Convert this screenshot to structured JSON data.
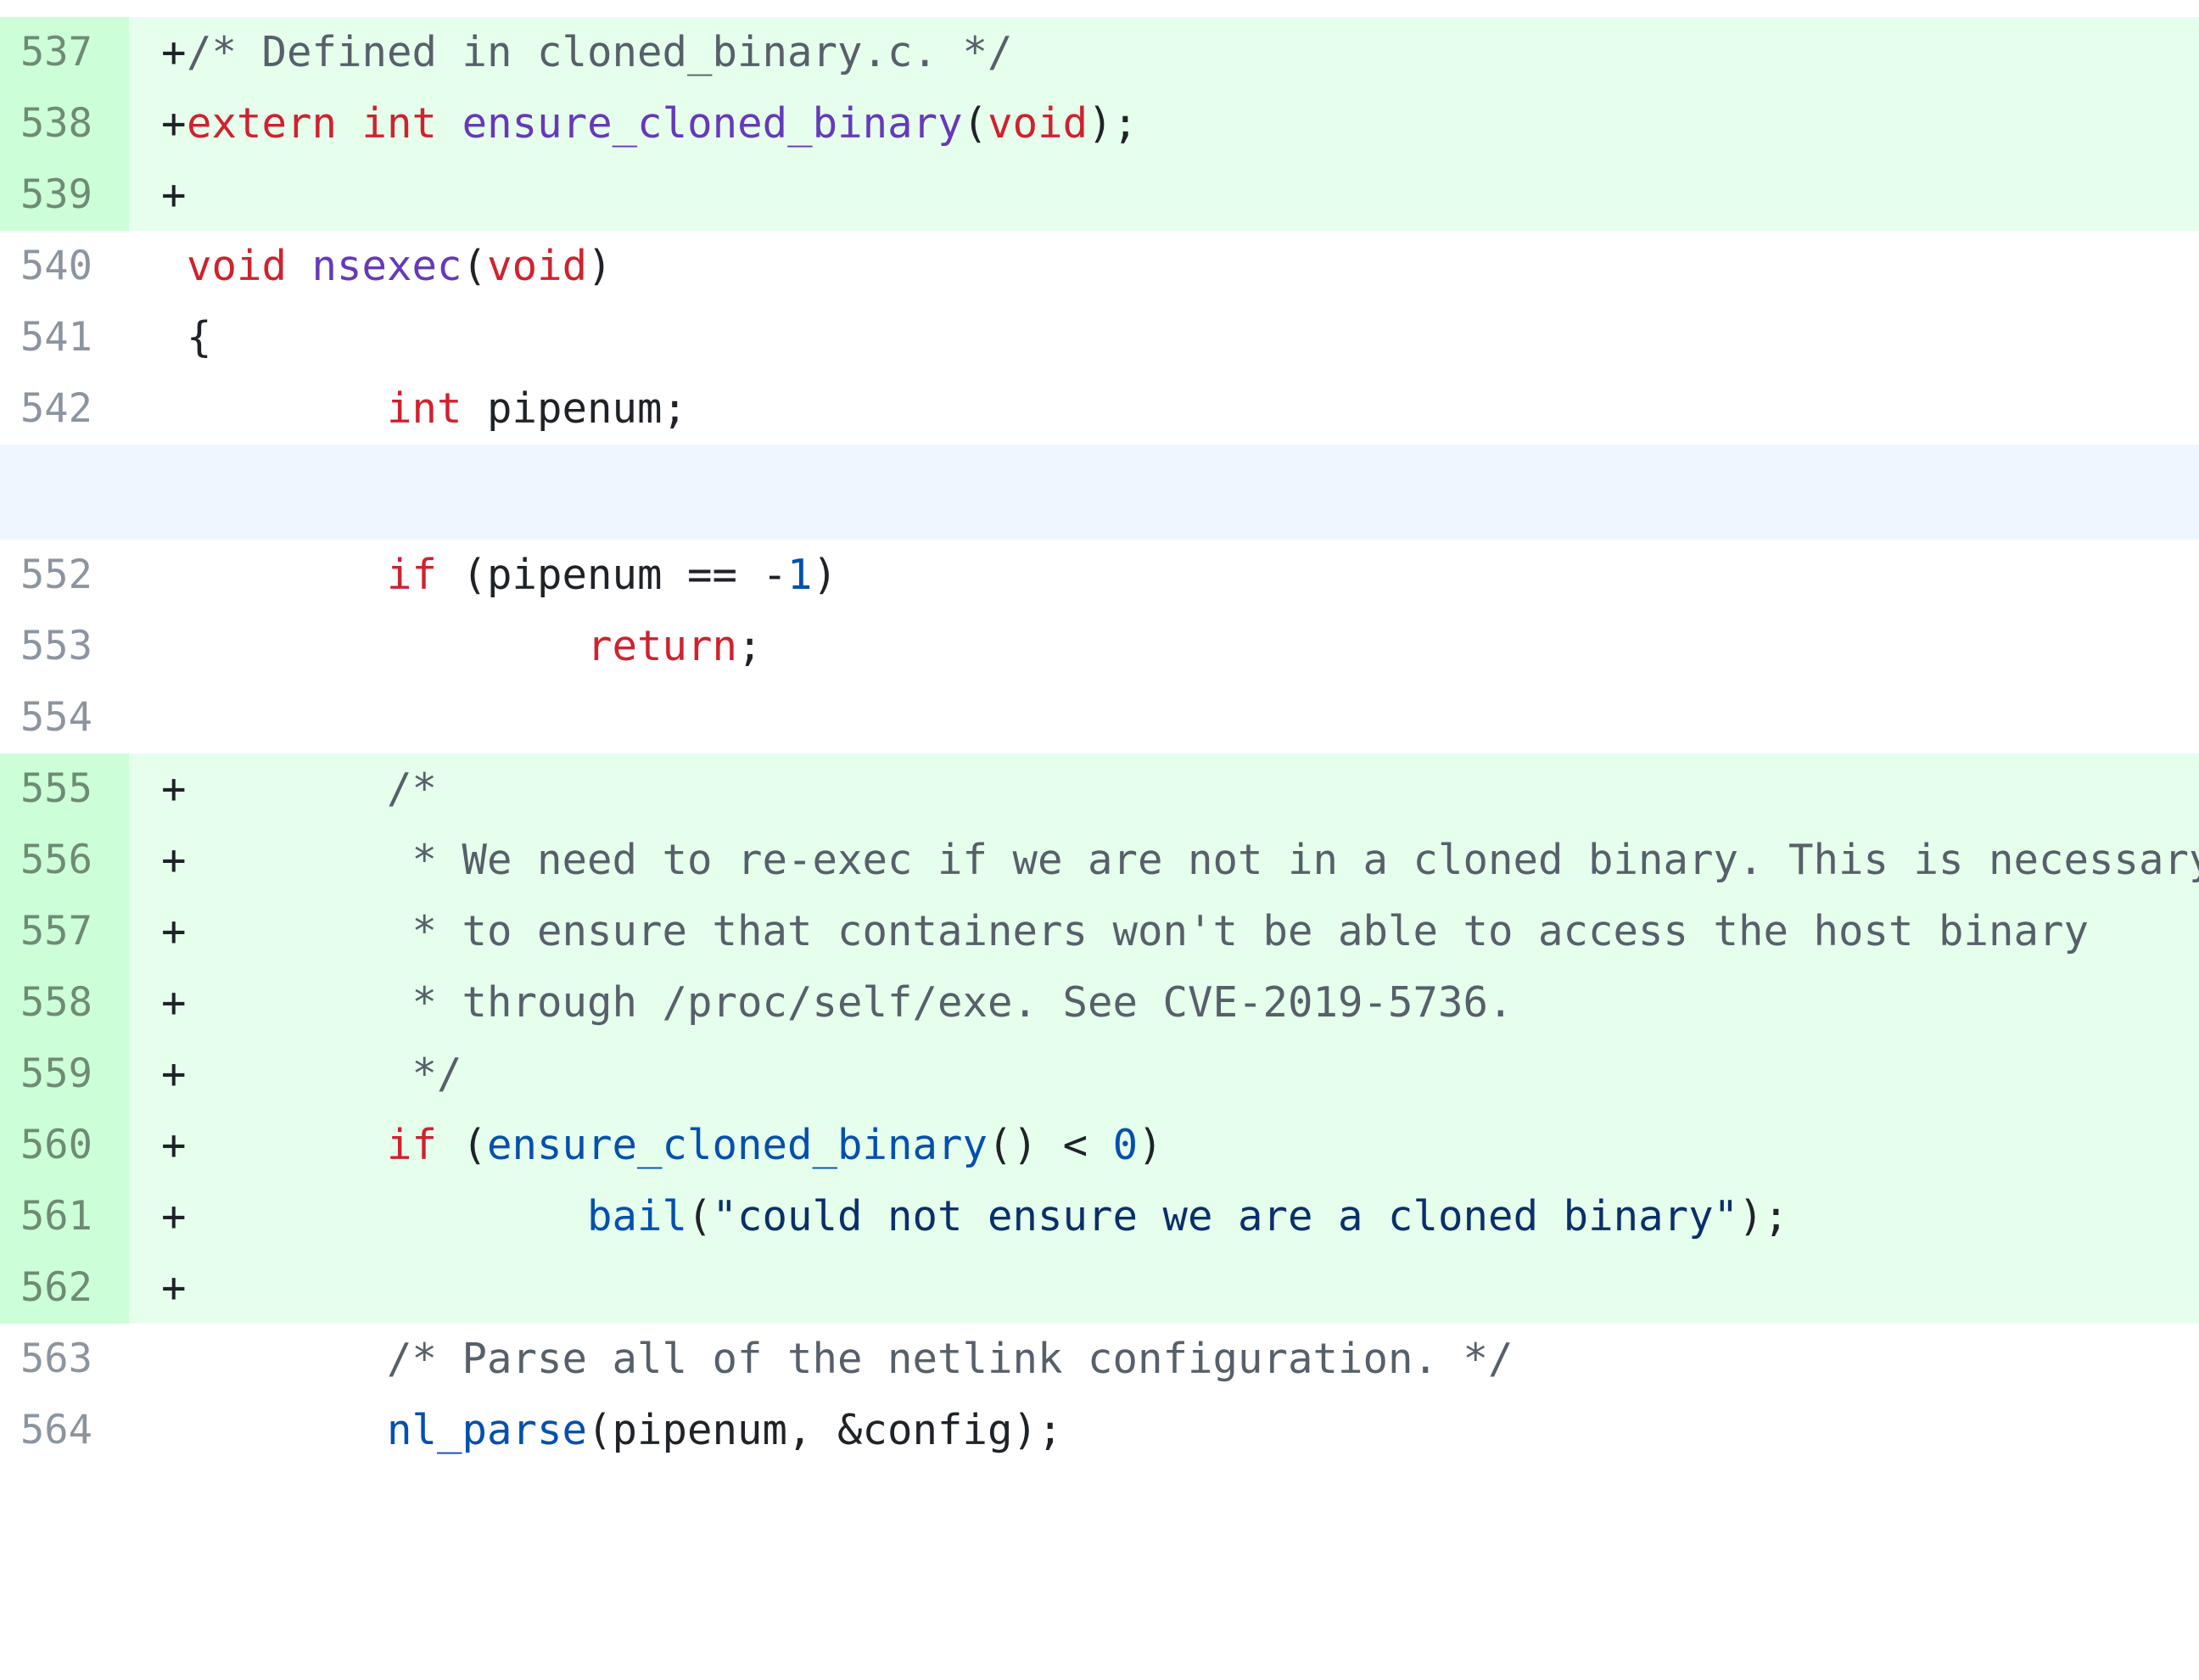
{
  "colors": {
    "added_background": "#e6ffec",
    "added_gutter": "#ccffd8",
    "hunk_background": "#f0f6ff",
    "keyword": "#cf222e",
    "function_name": "#6639ba",
    "call": "#0550ae",
    "string": "#0a3069",
    "comment": "#57606a",
    "line_number": "#8c959f"
  },
  "lines": [
    {
      "num": "537",
      "marker": "+",
      "tokens": [
        [
          "cm",
          "/* Defined in cloned_binary.c. */"
        ]
      ]
    },
    {
      "num": "538",
      "marker": "+",
      "tokens": [
        [
          "kw",
          "extern"
        ],
        [
          "",
          " "
        ],
        [
          "kw",
          "int"
        ],
        [
          "",
          " "
        ],
        [
          "fn",
          "ensure_cloned_binary"
        ],
        [
          "",
          "("
        ],
        [
          "kw",
          "void"
        ],
        [
          "",
          ");"
        ]
      ]
    },
    {
      "num": "539",
      "marker": "+",
      "tokens": []
    },
    {
      "num": "540",
      "marker": "",
      "tokens": [
        [
          "kw",
          "void"
        ],
        [
          "",
          " "
        ],
        [
          "fn",
          "nsexec"
        ],
        [
          "",
          "("
        ],
        [
          "kw",
          "void"
        ],
        [
          "",
          ")"
        ]
      ]
    },
    {
      "num": "541",
      "marker": "",
      "tokens": [
        [
          "",
          "{"
        ]
      ]
    },
    {
      "num": "542",
      "marker": "",
      "tokens": [
        [
          "",
          "        "
        ],
        [
          "kw",
          "int"
        ],
        [
          "",
          " pipenum;"
        ]
      ]
    },
    {
      "num": "552",
      "marker": "",
      "tokens": [
        [
          "",
          "        "
        ],
        [
          "kw",
          "if"
        ],
        [
          "",
          " (pipenum == -"
        ],
        [
          "num",
          "1"
        ],
        [
          "",
          ")"
        ]
      ]
    },
    {
      "num": "553",
      "marker": "",
      "tokens": [
        [
          "",
          "                "
        ],
        [
          "kw",
          "return"
        ],
        [
          "",
          ";"
        ]
      ]
    },
    {
      "num": "554",
      "marker": "",
      "tokens": []
    },
    {
      "num": "555",
      "marker": "+",
      "tokens": [
        [
          "",
          "        "
        ],
        [
          "cm",
          "/*"
        ]
      ]
    },
    {
      "num": "556",
      "marker": "+",
      "tokens": [
        [
          "",
          "        "
        ],
        [
          "cm",
          " * We need to re-exec if we are not in a cloned binary. This is necessary"
        ]
      ]
    },
    {
      "num": "557",
      "marker": "+",
      "tokens": [
        [
          "",
          "        "
        ],
        [
          "cm",
          " * to ensure that containers won't be able to access the host binary"
        ]
      ]
    },
    {
      "num": "558",
      "marker": "+",
      "tokens": [
        [
          "",
          "        "
        ],
        [
          "cm",
          " * through /proc/self/exe. See CVE-2019-5736."
        ]
      ]
    },
    {
      "num": "559",
      "marker": "+",
      "tokens": [
        [
          "",
          "        "
        ],
        [
          "cm",
          " */"
        ]
      ]
    },
    {
      "num": "560",
      "marker": "+",
      "tokens": [
        [
          "",
          "        "
        ],
        [
          "kw",
          "if"
        ],
        [
          "",
          " ("
        ],
        [
          "call",
          "ensure_cloned_binary"
        ],
        [
          "",
          "() < "
        ],
        [
          "num",
          "0"
        ],
        [
          "",
          ")"
        ]
      ]
    },
    {
      "num": "561",
      "marker": "+",
      "tokens": [
        [
          "",
          "                "
        ],
        [
          "call",
          "bail"
        ],
        [
          "",
          "("
        ],
        [
          "str",
          "\"could not ensure we are a cloned binary\""
        ],
        [
          "",
          ");"
        ]
      ]
    },
    {
      "num": "562",
      "marker": "+",
      "tokens": []
    },
    {
      "num": "563",
      "marker": "",
      "tokens": [
        [
          "",
          "        "
        ],
        [
          "cm",
          "/* Parse all of the netlink configuration. */"
        ]
      ]
    },
    {
      "num": "564",
      "marker": "",
      "tokens": [
        [
          "",
          "        "
        ],
        [
          "call",
          "nl_parse"
        ],
        [
          "",
          "(pipenum, &config);"
        ]
      ]
    }
  ]
}
